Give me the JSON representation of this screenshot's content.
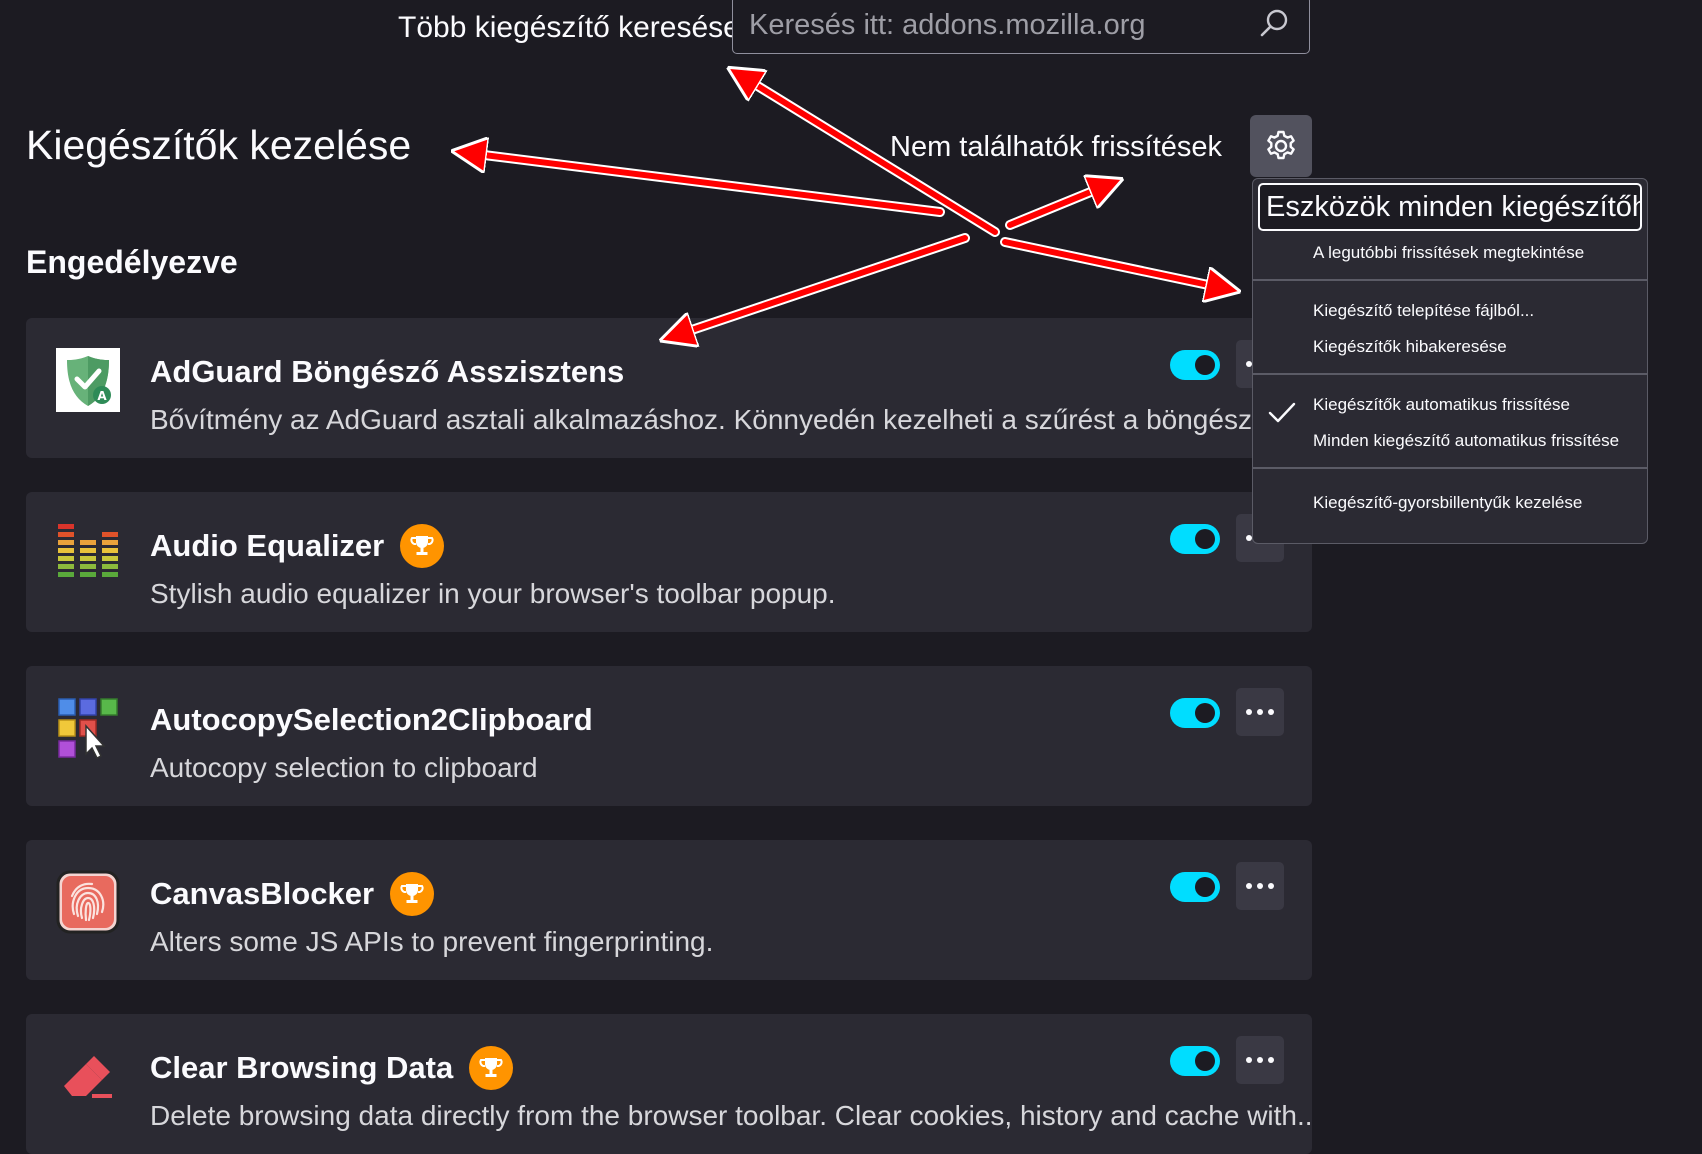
{
  "header": {
    "search_label": "Több kiegészítő keresése",
    "search_placeholder": "Keresés itt: addons.mozilla.org",
    "search_icon": "search-icon"
  },
  "page_title": "Kiegészítők kezelése",
  "update_status": "Nem találhatók frissítések",
  "gear_icon": "gear-icon",
  "section_title": "Engedélyezve",
  "addons": [
    {
      "name": "AdGuard Böngésző Asszisztens",
      "description": "Bővítmény az AdGuard asztali alkalmazáshoz. Könnyedén kezelheti a szűrést a böngészőből,",
      "icon": "adguard-shield-icon",
      "recommended": false,
      "enabled": true
    },
    {
      "name": "Audio Equalizer",
      "description": "Stylish audio equalizer in your browser's toolbar popup.",
      "icon": "equalizer-icon",
      "recommended": true,
      "enabled": true
    },
    {
      "name": "AutocopySelection2Clipboard",
      "description": "Autocopy selection to clipboard",
      "icon": "autocopy-grid-icon",
      "recommended": false,
      "enabled": true
    },
    {
      "name": "CanvasBlocker",
      "description": "Alters some JS APIs to prevent fingerprinting.",
      "icon": "fingerprint-icon",
      "recommended": true,
      "enabled": true
    },
    {
      "name": "Clear Browsing Data",
      "description": "Delete browsing data directly from the browser toolbar. Clear cookies, history and cache with...",
      "icon": "eraser-icon",
      "recommended": true,
      "enabled": true
    }
  ],
  "menu": {
    "header": "Eszközök minden kiegészítőhöz",
    "items": [
      {
        "label": "A legutóbbi frissítések megtekintése",
        "checked": false
      },
      {
        "label": "Kiegészítő telepítése fájlból...",
        "checked": false
      },
      {
        "label": "Kiegészítők hibakeresése",
        "checked": false
      },
      {
        "label": "Kiegészítők automatikus frissítése",
        "checked": true
      },
      {
        "label": "Minden kiegészítő automatikus frissítése",
        "checked": false
      },
      {
        "label": "Kiegészítő-gyorsbillentyűk kezelése",
        "checked": false
      }
    ]
  },
  "colors": {
    "background": "#1c1b22",
    "card": "#2b2a33",
    "toggle_on": "#00ddff",
    "badge": "#ff9400",
    "arrow": "#ff0000"
  }
}
